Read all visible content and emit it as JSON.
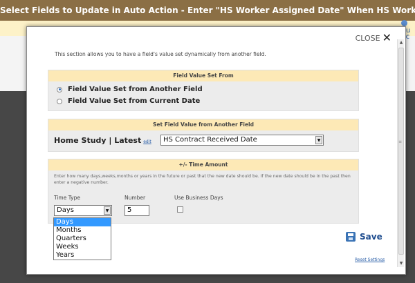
{
  "header": {
    "title": "Select Fields to Update in Auto Action - Enter \"HS Worker Assigned Date\" When HS Worker is Assigned"
  },
  "background": {
    "links": [
      "Au",
      "Ac"
    ]
  },
  "modal": {
    "close_label": "CLOSE",
    "intro": "This section allows you to have a field's value set dynamically from another field.",
    "value_set_from": {
      "heading": "Field Value Set From",
      "options": [
        "Field Value Set from Another Field",
        "Field Value Set from Current Date"
      ],
      "selected_index": 0
    },
    "set_from_field": {
      "heading": "Set Field Value from Another Field",
      "source_label": "Home Study | Latest",
      "edit_link": "edit",
      "field_value": "HS Contract Received Date"
    },
    "time_amount": {
      "heading": "+/- Time Amount",
      "help": "Enter how many days,weeks,months or years in the future or past that the new date should be. If the new date should be in the past then enter a negative number.",
      "time_type_label": "Time Type",
      "number_label": "Number",
      "business_days_label": "Use Business Days",
      "time_type_value": "Days",
      "number_value": "5",
      "business_days_checked": false,
      "time_type_options": [
        "Days",
        "Months",
        "Quarters",
        "Weeks",
        "Years"
      ],
      "time_type_highlighted": "Days"
    },
    "save_label": "Save",
    "reset_label": "Reset Settings"
  },
  "colors": {
    "header_bg": "#8b6f45",
    "section_head_bg": "#fde9b6",
    "link": "#2b5fa8",
    "highlight": "#3399ff"
  }
}
